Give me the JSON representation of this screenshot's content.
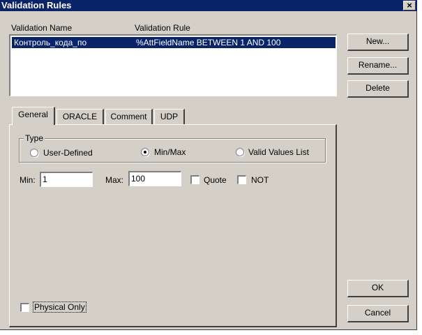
{
  "window": {
    "title": "Validation Rules",
    "close_glyph": "×"
  },
  "list": {
    "columns": [
      "Validation Name",
      "Validation Rule"
    ],
    "rows": [
      {
        "name": "Контроль_кода_по",
        "rule": "%AttFieldName BETWEEN 1 AND 100",
        "selected": true
      }
    ]
  },
  "buttons": {
    "new": "New...",
    "rename": "Rename...",
    "delete": "Delete",
    "ok": "OK",
    "cancel": "Cancel"
  },
  "tabs": [
    {
      "label": "General",
      "active": true
    },
    {
      "label": "ORACLE",
      "active": false
    },
    {
      "label": "Comment",
      "active": false
    },
    {
      "label": "UDP",
      "active": false
    }
  ],
  "type_group": {
    "label": "Type",
    "options": [
      {
        "label": "User-Defined",
        "checked": false
      },
      {
        "label": "Min/Max",
        "checked": true
      },
      {
        "label": "Valid Values List",
        "checked": false
      }
    ]
  },
  "fields": {
    "min_label": "Min:",
    "min_value": "1",
    "max_label": "Max:",
    "max_value": "100",
    "quote_label": "Quote",
    "quote_checked": false,
    "not_label": "NOT",
    "not_checked": false
  },
  "physical_only": {
    "label": "Physical Only",
    "checked": false
  },
  "colors": {
    "selection": "#0a246a",
    "face": "#d4d0c8",
    "titlebar": "#0a246a"
  }
}
